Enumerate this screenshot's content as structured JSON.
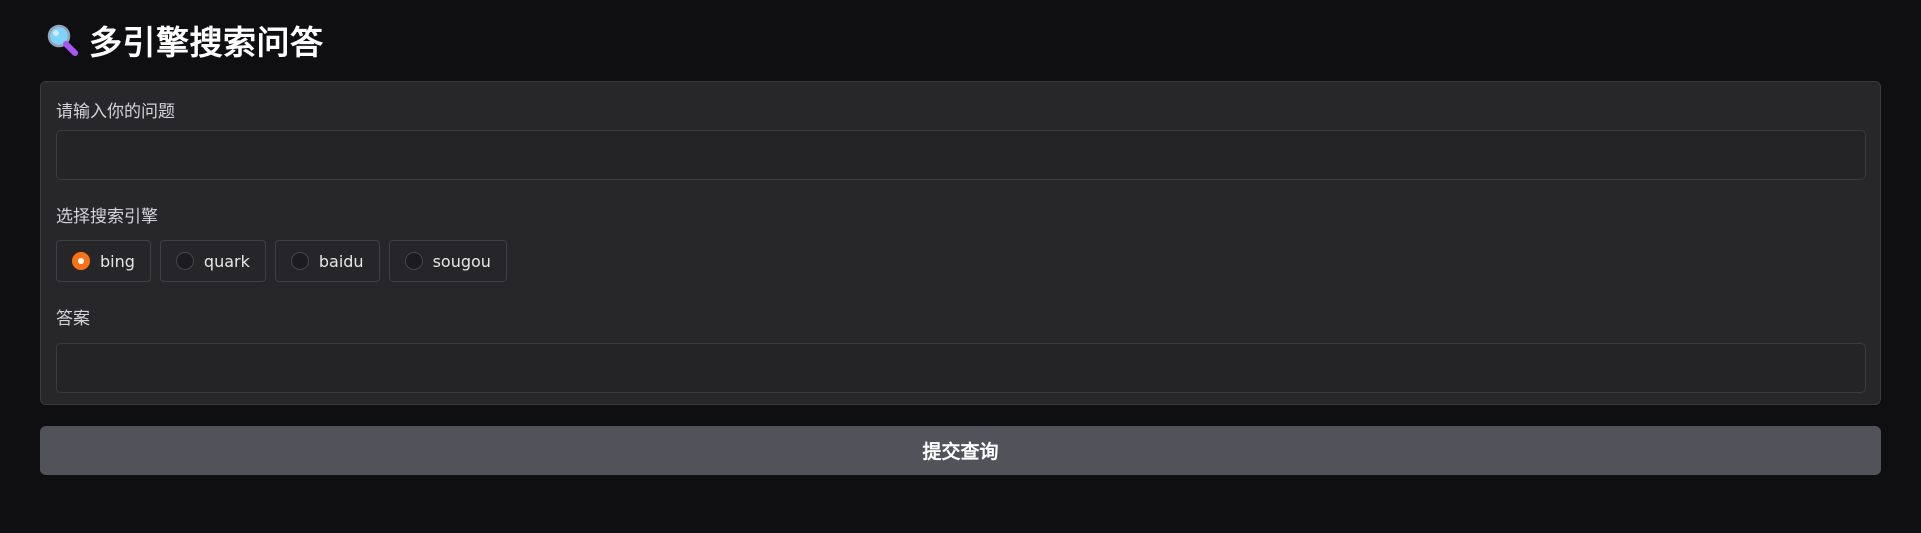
{
  "app": {
    "title": "多引擎搜索问答",
    "title_icon": "magnifying-glass-icon"
  },
  "question": {
    "label": "请输入你的问题",
    "value": "",
    "placeholder": ""
  },
  "engine": {
    "label": "选择搜索引擎",
    "options": [
      "bing",
      "quark",
      "baidu",
      "sougou"
    ],
    "selected": "bing"
  },
  "answer": {
    "label": "答案",
    "value": ""
  },
  "submit": {
    "label": "提交查询"
  },
  "colors": {
    "accent": "#f97316",
    "background": "#0f0f11",
    "panel": "#27272a",
    "button": "#52525b"
  }
}
